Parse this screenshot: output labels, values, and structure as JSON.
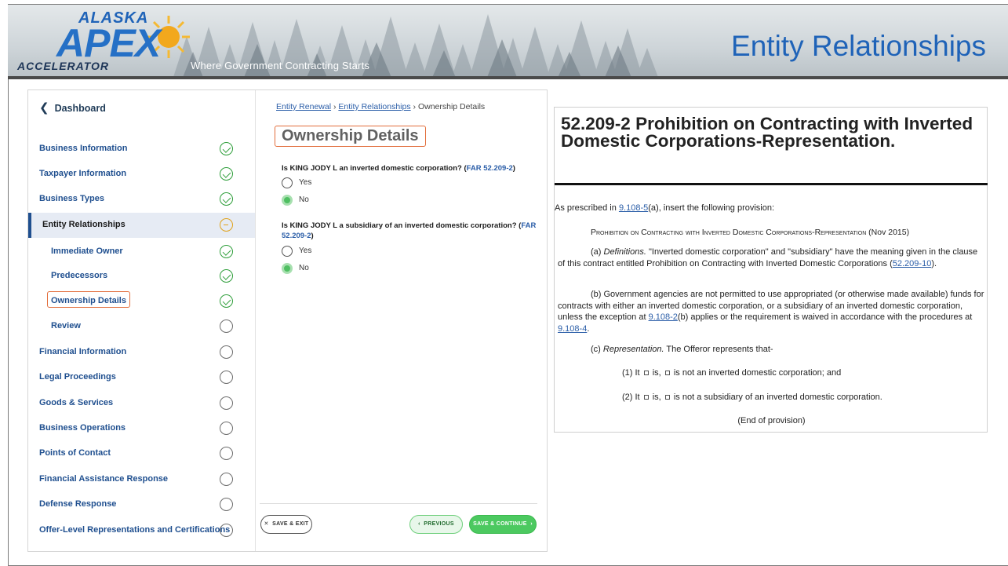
{
  "banner": {
    "logo": {
      "line1": "ALASKA",
      "line2": "APEX",
      "line3": "ACCELERATOR"
    },
    "tagline": "Where Government Contracting Starts",
    "slide_title": "Entity Relationships"
  },
  "app": {
    "back_link": "Dashboard",
    "nav": [
      {
        "label": "Business Information",
        "status": "complete"
      },
      {
        "label": "Taxpayer Information",
        "status": "complete"
      },
      {
        "label": "Business Types",
        "status": "complete"
      },
      {
        "label": "Entity Relationships",
        "status": "in-progress"
      },
      {
        "label": "Immediate Owner",
        "status": "complete"
      },
      {
        "label": "Predecessors",
        "status": "complete"
      },
      {
        "label": "Ownership Details",
        "status": "complete"
      },
      {
        "label": "Review",
        "status": "not-started"
      },
      {
        "label": "Financial Information",
        "status": "not-started"
      },
      {
        "label": "Legal Proceedings",
        "status": "not-started"
      },
      {
        "label": "Goods & Services",
        "status": "not-started"
      },
      {
        "label": "Business Operations",
        "status": "not-started"
      },
      {
        "label": "Points of Contact",
        "status": "not-started"
      },
      {
        "label": "Financial Assistance Response",
        "status": "not-started"
      },
      {
        "label": "Defense Response",
        "status": "not-started"
      },
      {
        "label": "Offer-Level Representations and Certifications",
        "status": "not-started"
      }
    ],
    "breadcrumb": {
      "item1": "Entity Renewal",
      "item2": "Entity Relationships",
      "current": "Ownership Details",
      "separator": "›"
    },
    "page_title": "Ownership Details",
    "q1": {
      "text": "Is KING JODY L an inverted domestic corporation? (",
      "link": "FAR 52.209-2",
      "close": ")",
      "yes": "Yes",
      "no": "No",
      "selected": "No"
    },
    "q2": {
      "text": "Is KING JODY L a subsidiary of an inverted domestic corporation? (",
      "link": "FAR 52.209-2",
      "close": ")",
      "yes": "Yes",
      "no": "No",
      "selected": "No"
    },
    "buttons": {
      "exit": "SAVE & EXIT",
      "previous": "PREVIOUS",
      "next": "SAVE & CONTINUE"
    }
  },
  "doc": {
    "heading": "52.209-2  Prohibition on Contracting with Inverted Domestic Corporations-Representation.",
    "intro_pre": "As prescribed in ",
    "intro_link": "9.108-5",
    "intro_post": "(a), insert the following provision:",
    "provision_title": "Prohibition on Contracting with Inverted Domestic Corporations-Representation",
    "provision_date": "(Nov 2015)",
    "para_a_label": "(a) ",
    "para_a_term": "Definitions.",
    "para_a_text": " \"Inverted domestic corporation\" and \"subsidiary\" have the meaning given in the clause of this contract entitled Prohibition on Contracting with Inverted Domestic Corporations (",
    "para_a_link": "52.209-10",
    "para_a_end": ").",
    "para_b_text": "(b) Government agencies are not permitted to use appropriated (or otherwise made available) funds for contracts with either an inverted domestic corporation, or a subsidiary of an inverted domestic corporation, unless the exception at ",
    "para_b_link1": "9.108-2",
    "para_b_mid": "(b) applies or the requirement is waived in accordance with the procedures at ",
    "para_b_link2": "9.108-4",
    "para_b_end": ".",
    "para_c_label": "(c) ",
    "para_c_term": "Representation.",
    "para_c_text": " The Offeror represents that-",
    "item1_a": "(1) It ",
    "item1_b": " is, ",
    "item1_c": " is not an inverted domestic corporation; and",
    "item2_a": "(2) It ",
    "item2_b": " is, ",
    "item2_c": " is not a subsidiary of an inverted domestic corporation.",
    "end": "(End of provision)"
  }
}
